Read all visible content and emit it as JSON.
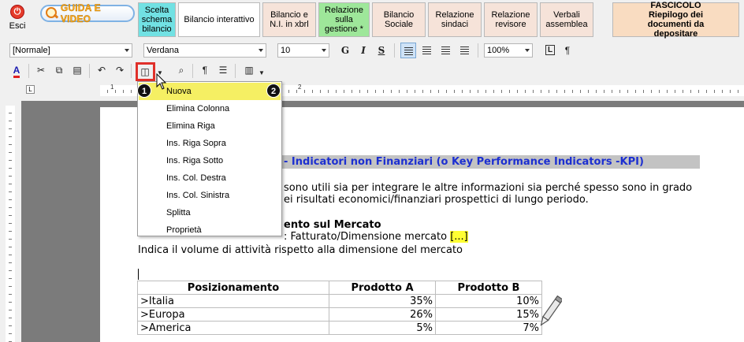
{
  "nav": {
    "exit_label": "Esci",
    "guide_label": "GUIDA E VIDEO",
    "tabs": [
      {
        "label": "Scelta schema bilancio"
      },
      {
        "label": "Bilancio interattivo"
      },
      {
        "label": "Bilancio e N.I. in xbrl"
      },
      {
        "label": "Relazione sulla gestione *"
      },
      {
        "label": "Bilancio Sociale"
      },
      {
        "label": "Relazione sindaci"
      },
      {
        "label": "Relazione revisore"
      },
      {
        "label": "Verbali assemblea"
      }
    ],
    "fascicolo_title": "FASCICOLO",
    "fascicolo_subtitle": "Riepilogo dei documenti da depositare"
  },
  "toolbar": {
    "style_value": "[Normale]",
    "font_value": "Verdana",
    "size_value": "10",
    "zoom_value": "100%",
    "bold": "G",
    "italic": "I",
    "underline": "S",
    "pilcrow": "¶",
    "format_mark": "L",
    "font_color": "A"
  },
  "ruler": {
    "tab_marker": "L",
    "numbers": [
      "1",
      "2"
    ]
  },
  "menu": {
    "items": [
      {
        "label": "Nuova"
      },
      {
        "label": "Elimina Colonna"
      },
      {
        "label": "Elimina Riga"
      },
      {
        "label": "Ins. Riga Sopra"
      },
      {
        "label": "Ins. Riga Sotto"
      },
      {
        "label": "Ins. Col. Destra"
      },
      {
        "label": "Ins. Col. Sinistra"
      },
      {
        "label": "Splitta"
      },
      {
        "label": "Proprietà"
      }
    ]
  },
  "callouts": [
    "1",
    "2"
  ],
  "document": {
    "heading": "- Indicatori non Finanziari (o Key Performance Indicators -KPI)",
    "para_line1": "sono utili sia per integrare le altre informazioni sia perché spesso sono in grado",
    "para_line2": "ei risultati economici/finanziari prospettici di lungo periodo.",
    "section_title": "ento sul Mercato",
    "formula_label": ": Fatturato/Dimensione mercato",
    "formula_placeholder": "[...]",
    "description": "Indica il volume di attività rispetto alla dimensione del mercato",
    "table": {
      "headers": [
        "Posizionamento",
        "Prodotto A",
        "Prodotto B"
      ],
      "rows": [
        [
          ">Italia",
          "35%",
          "10%"
        ],
        [
          ">Europa",
          "26%",
          "15%"
        ],
        [
          ">America",
          "5%",
          "7%"
        ]
      ]
    }
  }
}
